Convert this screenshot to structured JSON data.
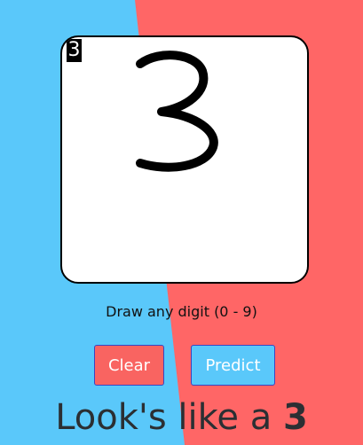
{
  "theme": {
    "blue": "#5ac8fa",
    "red": "#ff6666",
    "clear_button_color": "#f96461",
    "predict_button_color": "#5ac8fa"
  },
  "canvas": {
    "preview_digit": "3",
    "drawn_digit_description": "hand-drawn digit 3 stroke"
  },
  "instruction": "Draw any digit (0 - 9)",
  "buttons": {
    "clear": "Clear",
    "predict": "Predict"
  },
  "result": {
    "prefix": "Look's like a ",
    "digit": "3"
  }
}
